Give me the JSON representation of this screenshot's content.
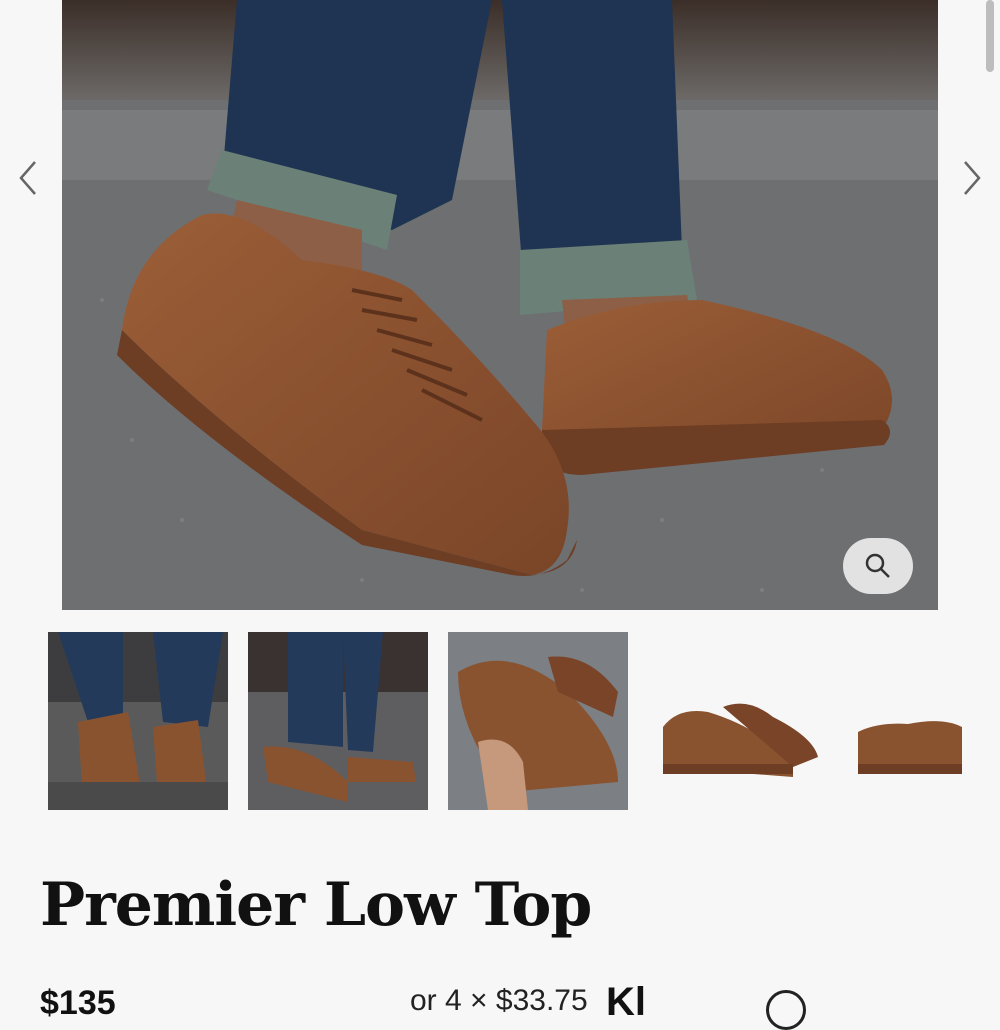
{
  "gallery": {
    "main_image_alt": "Brown leather low top sneakers worn with rolled-up jeans",
    "prev_icon": "chevron-left-icon",
    "next_icon": "chevron-right-icon",
    "zoom_icon": "magnifier-icon"
  },
  "thumbnails": [
    {
      "alt": "Lacing up brown sneakers on steps"
    },
    {
      "alt": "Walking in brown sneakers"
    },
    {
      "alt": "Holding a brown sneaker"
    },
    {
      "alt": "Pair of brown sneakers side view"
    },
    {
      "alt": "Brown sneaker side view"
    }
  ],
  "product": {
    "title": "Premier Low Top",
    "price": "$135",
    "installment": "or 4 × $33.75",
    "pay_provider": "Kl"
  },
  "colors": {
    "leather": "#8a5330",
    "sole": "#7a4428",
    "denim": "#1f3352",
    "asphalt": "#6c6d6f",
    "background": "#f7f7f7"
  }
}
